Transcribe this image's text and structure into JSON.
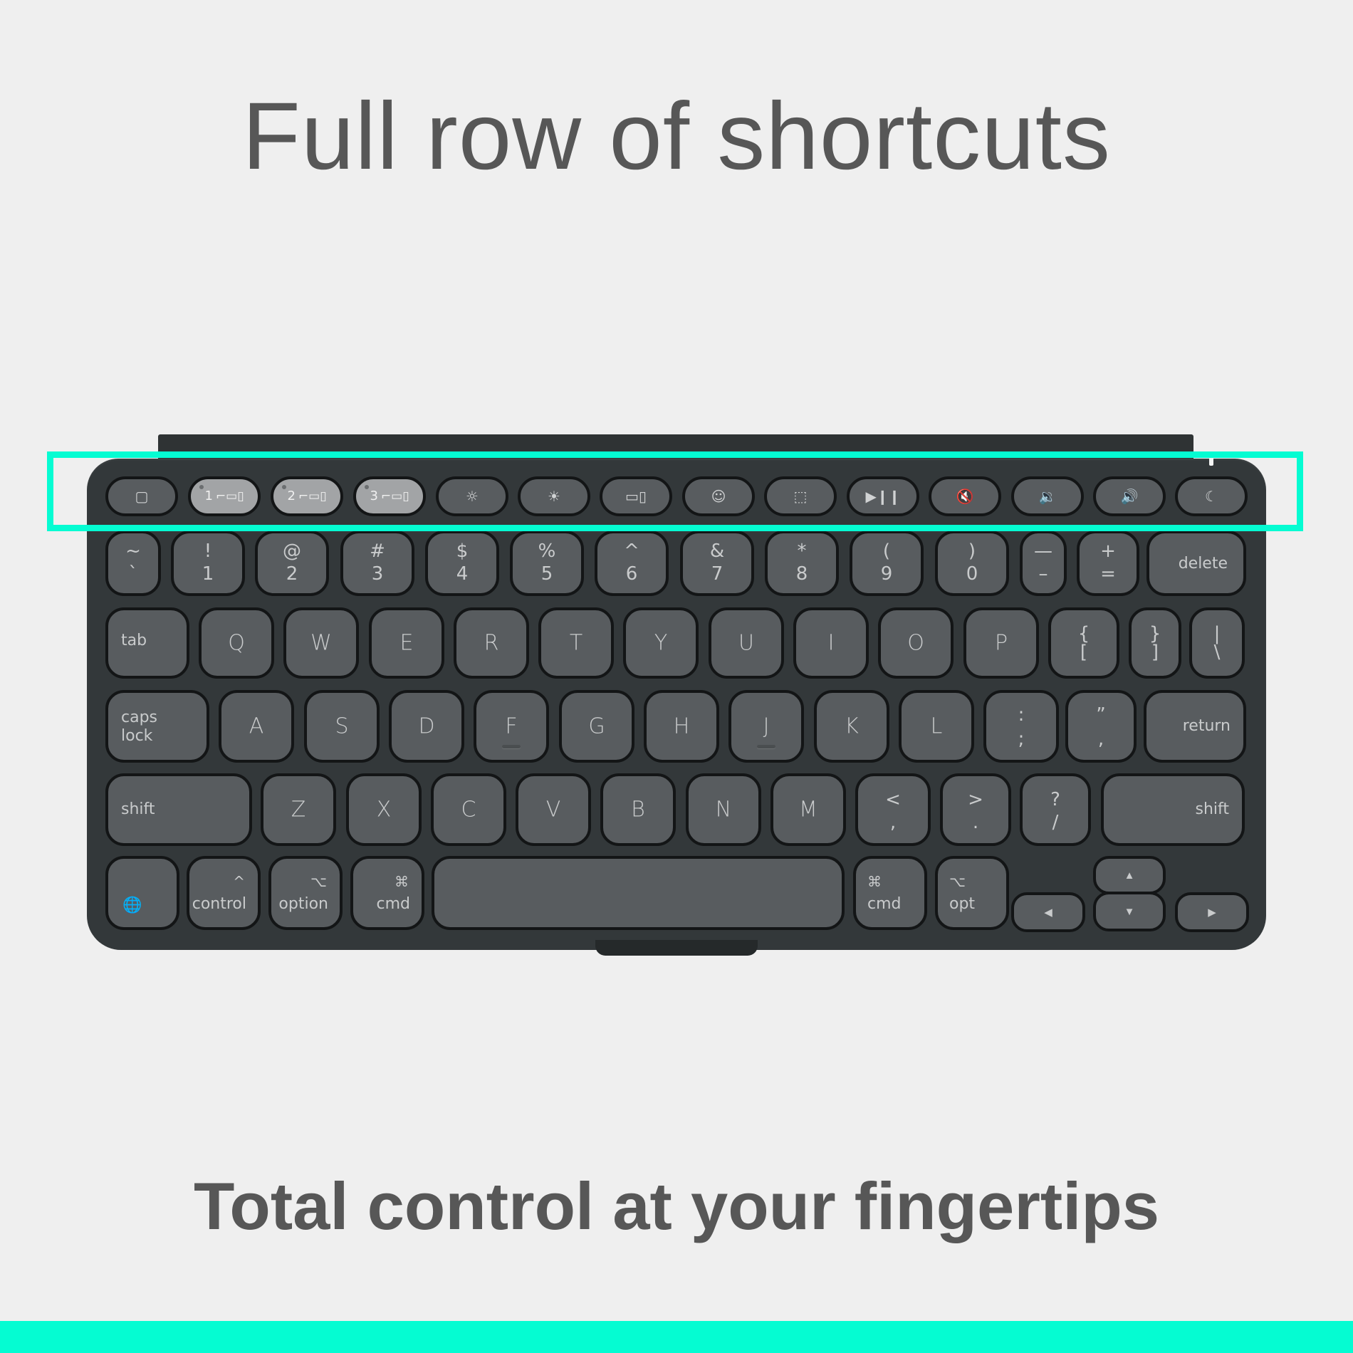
{
  "colors": {
    "accent": "#05fcd2",
    "background": "#efefef",
    "text": "#575757",
    "keyboard_body": "#33383a",
    "key_cap": "#585c5f",
    "key_cap_light": "#a2a4a6",
    "key_legend": "#c9cbcc"
  },
  "header": {
    "title": "Full row of shortcuts"
  },
  "footer": {
    "subtitle": "Total control at your fingertips"
  },
  "keyboard": {
    "function_row": [
      {
        "name": "tablet-key",
        "icon": "tablet-icon",
        "glyph": "▢",
        "label": ""
      },
      {
        "name": "easy-switch-1-key",
        "icon": "devices-icon",
        "glyph": "⌐▭▯",
        "label": "1"
      },
      {
        "name": "easy-switch-2-key",
        "icon": "devices-icon",
        "glyph": "⌐▭▯",
        "label": "2"
      },
      {
        "name": "easy-switch-3-key",
        "icon": "devices-icon",
        "glyph": "⌐▭▯",
        "label": "3"
      },
      {
        "name": "brightness-down-key",
        "icon": "brightness-down-icon",
        "glyph": "☼",
        "label": ""
      },
      {
        "name": "brightness-up-key",
        "icon": "brightness-up-icon",
        "glyph": "☀",
        "label": ""
      },
      {
        "name": "app-switch-key",
        "icon": "windows-icon",
        "glyph": "▭▯",
        "label": ""
      },
      {
        "name": "emoji-key",
        "icon": "emoji-icon",
        "glyph": "☺",
        "label": ""
      },
      {
        "name": "screenshot-key",
        "icon": "screenshot-icon",
        "glyph": "⬚",
        "label": ""
      },
      {
        "name": "play-pause-key",
        "icon": "play-pause-icon",
        "glyph": "▶❙❙",
        "label": ""
      },
      {
        "name": "mute-key",
        "icon": "mute-icon",
        "glyph": "🔇",
        "label": ""
      },
      {
        "name": "volume-down-key",
        "icon": "volume-down-icon",
        "glyph": "🔉",
        "label": ""
      },
      {
        "name": "volume-up-key",
        "icon": "volume-up-icon",
        "glyph": "🔊",
        "label": ""
      },
      {
        "name": "lock-key",
        "icon": "moon-icon",
        "glyph": "☾",
        "label": ""
      }
    ],
    "number_row": [
      {
        "top": "~",
        "bottom": "`"
      },
      {
        "top": "!",
        "bottom": "1"
      },
      {
        "top": "@",
        "bottom": "2"
      },
      {
        "top": "#",
        "bottom": "3"
      },
      {
        "top": "$",
        "bottom": "4"
      },
      {
        "top": "%",
        "bottom": "5"
      },
      {
        "top": "^",
        "bottom": "6"
      },
      {
        "top": "&",
        "bottom": "7"
      },
      {
        "top": "*",
        "bottom": "8"
      },
      {
        "top": "(",
        "bottom": "9"
      },
      {
        "top": ")",
        "bottom": "0"
      },
      {
        "top": "—",
        "bottom": "–"
      },
      {
        "top": "+",
        "bottom": "="
      },
      {
        "label": "delete"
      }
    ],
    "qwerty_row": [
      {
        "label": "tab"
      },
      {
        "char": "Q"
      },
      {
        "char": "W"
      },
      {
        "char": "E"
      },
      {
        "char": "R"
      },
      {
        "char": "T"
      },
      {
        "char": "Y"
      },
      {
        "char": "U"
      },
      {
        "char": "I"
      },
      {
        "char": "O"
      },
      {
        "char": "P"
      },
      {
        "top": "{",
        "bottom": "["
      },
      {
        "top": "}",
        "bottom": "]"
      },
      {
        "top": "|",
        "bottom": "\\"
      }
    ],
    "home_row": [
      {
        "label": "caps\nlock"
      },
      {
        "char": "A"
      },
      {
        "char": "S"
      },
      {
        "char": "D"
      },
      {
        "char": "F"
      },
      {
        "char": "G"
      },
      {
        "char": "H"
      },
      {
        "char": "J"
      },
      {
        "char": "K"
      },
      {
        "char": "L"
      },
      {
        "top": ":",
        "bottom": ";"
      },
      {
        "top": "”",
        "bottom": ","
      },
      {
        "label": "return"
      }
    ],
    "shift_row": [
      {
        "label": "shift"
      },
      {
        "char": "Z"
      },
      {
        "char": "X"
      },
      {
        "char": "C"
      },
      {
        "char": "V"
      },
      {
        "char": "B"
      },
      {
        "char": "N"
      },
      {
        "char": "M"
      },
      {
        "top": "<",
        "bottom": ","
      },
      {
        "top": ">",
        "bottom": "."
      },
      {
        "top": "?",
        "bottom": "/"
      },
      {
        "label": "shift"
      }
    ],
    "bottom_row": {
      "globe": {
        "icon": "globe-icon",
        "glyph": "🌐"
      },
      "control": {
        "symbol": "^",
        "label": "control"
      },
      "option": {
        "symbol": "⌥",
        "label": "option"
      },
      "cmd_left": {
        "symbol": "⌘",
        "label": "cmd"
      },
      "space": {
        "label": ""
      },
      "cmd_right": {
        "symbol": "⌘",
        "label": "cmd"
      },
      "opt": {
        "symbol": "⌥",
        "label": "opt"
      },
      "arrow_left": "◀",
      "arrow_up": "▲",
      "arrow_down": "▼",
      "arrow_right": "▶"
    }
  }
}
